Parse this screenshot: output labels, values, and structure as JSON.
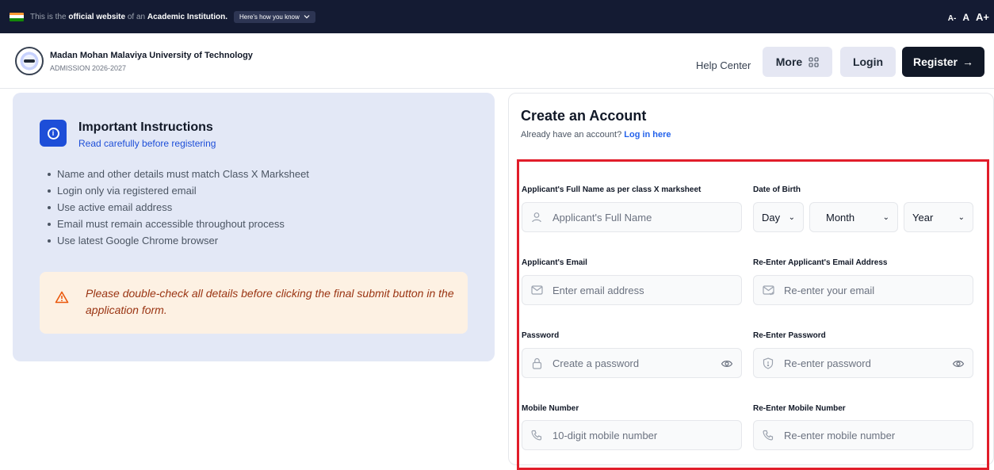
{
  "topbar": {
    "pre": "This is the",
    "official": "official website",
    "mid": "of an",
    "institution": "Academic Institution.",
    "how_btn": "Here's how you know",
    "sizes": [
      "A-",
      "A",
      "A+"
    ]
  },
  "header": {
    "university": "Madan Mohan Malaviya University of Technology",
    "subtitle": "ADMISSION 2026-2027",
    "help": "Help Center",
    "more": "More",
    "login": "Login",
    "register": "Register",
    "register_arrow": "→"
  },
  "instructions": {
    "title": "Important Instructions",
    "subtitle": "Read carefully before registering",
    "items": [
      "Name and other details must match Class X Marksheet",
      "Login only via registered email",
      "Use active email address",
      "Email must remain accessible throughout process",
      "Use latest Google Chrome browser"
    ],
    "warning": "Please double-check all details before clicking the final submit button in the application form."
  },
  "form": {
    "title": "Create an Account",
    "already": "Already have an account?",
    "login_link": "Log in here",
    "full_name": {
      "label": "Applicant's Full Name as per class X marksheet",
      "placeholder": "Applicant's Full Name"
    },
    "dob": {
      "label": "Date of Birth",
      "day": "Day",
      "month": "Month",
      "year": "Year"
    },
    "email": {
      "label": "Applicant's Email",
      "placeholder": "Enter email address"
    },
    "email_confirm": {
      "label": "Re-Enter Applicant's Email Address",
      "placeholder": "Re-enter your email"
    },
    "password": {
      "label": "Password",
      "placeholder": "Create a password"
    },
    "password_confirm": {
      "label": "Re-Enter Password",
      "placeholder": "Re-enter password"
    },
    "mobile": {
      "label": "Mobile Number",
      "placeholder": "10-digit mobile number"
    },
    "mobile_confirm": {
      "label": "Re-Enter Mobile Number",
      "placeholder": "Re-enter mobile number"
    }
  },
  "colors": {
    "topbar_bg": "#141b33",
    "accent_blue": "#1d4ed8",
    "link_blue": "#2563eb",
    "register_bg": "#111827",
    "highlight_red": "#e11d2a",
    "warning_bg": "#fdf1e3",
    "warning_text": "#9a3412"
  },
  "icons": {
    "info": "info-icon",
    "warning": "warning-triangle-icon",
    "user": "user-icon",
    "mail": "mail-icon",
    "lock": "lock-icon",
    "shield": "shield-icon",
    "eye": "eye-icon",
    "phone": "phone-icon",
    "grid": "grid-icon",
    "chevron": "chevron-down-icon"
  }
}
